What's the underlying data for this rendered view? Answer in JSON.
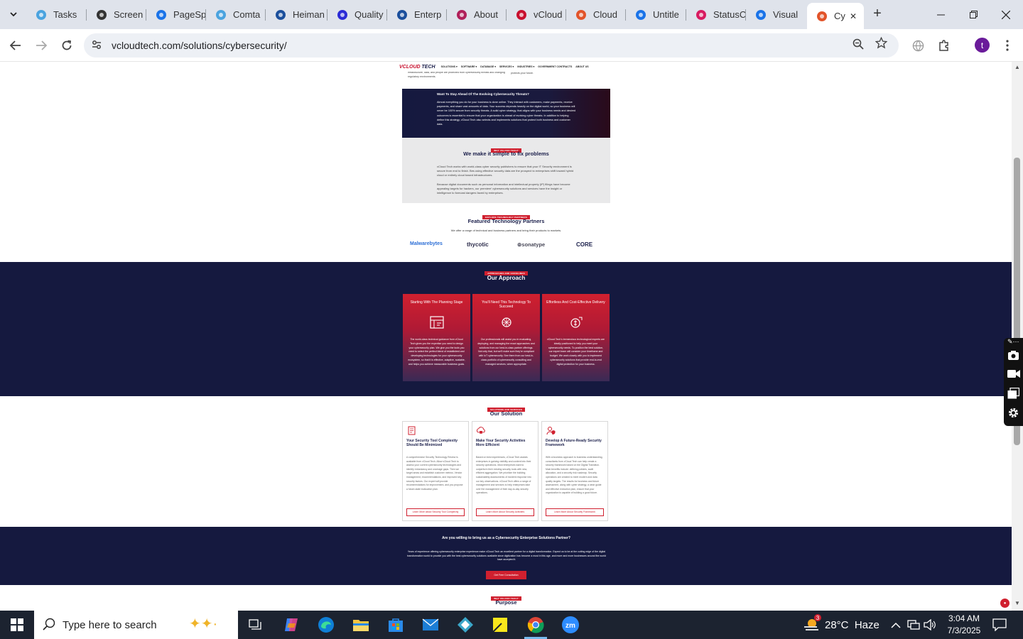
{
  "browser": {
    "tabs": [
      {
        "label": "Tasks",
        "icon": "tasks-icon",
        "color": "#4aa3df"
      },
      {
        "label": "Screen",
        "icon": "screen-icon",
        "color": "#333"
      },
      {
        "label": "PageSp",
        "icon": "pagespeed-icon",
        "color": "#1a73e8"
      },
      {
        "label": "Comta",
        "icon": "comta-icon",
        "color": "#4aa3df"
      },
      {
        "label": "Heiman",
        "icon": "heiman-icon",
        "color": "#1b4f9c"
      },
      {
        "label": "Quality",
        "icon": "quality-icon",
        "color": "#2b2bd6"
      },
      {
        "label": "Enterp",
        "icon": "enterprise-icon",
        "color": "#1b4f9c"
      },
      {
        "label": "About",
        "icon": "about-icon",
        "color": "#b0205a"
      },
      {
        "label": "vCloud",
        "icon": "vcloud-icon",
        "color": "#c8102e"
      },
      {
        "label": "Cloud",
        "icon": "cloud-icon",
        "color": "#e2542a"
      },
      {
        "label": "Untitle",
        "icon": "docs-icon",
        "color": "#1a73e8"
      },
      {
        "label": "StatusC",
        "icon": "status-icon",
        "color": "#d81b60"
      },
      {
        "label": "Visual",
        "icon": "visual-icon",
        "color": "#1a73e8"
      },
      {
        "label": "Cy",
        "icon": "cyber-icon",
        "color": "#e2542a"
      }
    ],
    "url": "vcloudtech.com/solutions/cybersecurity/",
    "profile_initial": "t"
  },
  "site": {
    "logo_main": "VCLOUD",
    "logo_accent": "TECH",
    "nav": [
      "SOLUTIONS ▾",
      "SOFTWARE ▾",
      "DATABASE ▾",
      "SERVICES ▾",
      "INDUSTRIES ▾",
      "GOVERNMENT CONTRACTS",
      "ABOUT US"
    ],
    "top_snippet_left": "infrastructure, data, and people are protected from cybersecurity threats and changing regulatory environments.",
    "top_snippet_right": "protects your future.",
    "hero_heading": "Want To Stay Ahead Of The Evolving Cybersecurity Threats?",
    "hero_text": "Almost everything you do for your business is done online. They interact with customers, make payments, receive payments, and share vast amounts of data. Your success depends heavily on the digital world, so your business will never be 100% secure from security threats. A solid cyber strategy, that aligns with your business needs and desired outcomes is essential to ensure that your organization is ahead of evolving cyber threats. In addition to helping define this strategy, vCloud Tech also selects and implements solutions that protect both business and customer data.",
    "why_badge": "WHY VCLOUD TECH?",
    "why_title": "We make it simple to fix problems",
    "why_p1": "vCloud Tech works with world-class cyber security publishers to ensure that your IT Security environment is secure from end to finish. Bes using effective security data are the prospect to enterprises shift toward hybrid cloud or entirely cloud based infrastructures.",
    "why_p2": "Because digital documents such as personal information and intellectual property (IP) filings have become appealing targets for hackers, our premiere' cybersecurity solutions and services have the insight or intelligence to forecast dangers faced by enterprises.",
    "partners_badge": "EXPLORE TECHNOLOGY PARTNERS",
    "partners_title": "Featured Technology Partners",
    "partners_sub": "We offer a range of technical and business partners and bring their products to markets.",
    "partners": [
      "Malwarebytes",
      "thycotic",
      "sonatype",
      "CORE"
    ],
    "approach_badge": "APPROACHES AND GUIDELINES",
    "approach_title": "Our Approach",
    "approach_cards": [
      {
        "title": "Starting With The Planning Stage",
        "text": "The world-class technical guidance from vCloud Tech gives you the expertise you need to design your cybersecurity plan. We give you the tools you need to select the perfect blend of established and developing technologies for your cybersecurity ecosystem, so that it is effective, adaptive, scalable, and helps you achieve measurable business goals."
      },
      {
        "title": "You'll Need This Technology To Succeed",
        "text": "Our professionals will assist you in evaluating, deploying, and managing the exact approaches and solutions from our best-in-class partner offerings. Not only that, but we'll make sure they're compliant with IoT cybersecurity. See them from our best-in-class portfolio of cybersecurity consulting and managed services, when appropriate."
      },
      {
        "title": "Effortless And Cost-Effective Delivery",
        "text": "vCloud Tech's tremendous technological experts are ideally positioned to help you meet your cybersecurity needs. To position the best solution, our expert team will consider your timeframe and budget. We work closely with you to implement cybersecurity solutions that provide end-to-end digital protection for your business."
      }
    ],
    "solution_badge": "SOLUTIONS AND SERVICES",
    "solution_title": "Our Solution",
    "solution_cards": [
      {
        "title": "Your Security Tool Complexity Should Be Minimized",
        "text": "A comprehensive Security Technology Review is available from vCloud Tech. Allow vCloud Tech to assess your current cybersecurity technologies and identify redundancy and coverage gaps. Then we target areas and establish customer metrics. Vendor management, recommendations, and improved key security factors. Our expert will provide recommendations for improvement, and you propose a future-state evaluation plan.",
        "button": "Learn More about Security Tool Complexity"
      },
      {
        "title": "Make Your Security Activities More Efficient",
        "text": "Based on best experiences, vCloud Tech assists enterprises in gaining visibility and content into their security operations. Most enterprises want to outperform their existing security tools with new, efficient aggregation. We prioritize the building sustainability assessments of incident response into our key observations. vCloud Tech offers a range of management and services to help enterprises take over the management of their day-to-day security operations.",
        "button": "Learn More About Security Activities"
      },
      {
        "title": "Develop A Future-Ready Security Framework",
        "text": "With a business approach to business understanding, consultants from vCloud Tech can help create a security framework based on the Digital Transition. Main benefits include: defining policies, audit allocation, and a security risk roadmap. Security operations are created to meet modern and data quality targets. The results for business and future assessment, along with cyber strategy, a clear guide and effective execution plan, ensure that your organization is capable of building a good future.",
        "button": "Learn More About Security Framework"
      }
    ],
    "cta_question": "Are you willing to bring us as a Cybersecurity Enterprise Solutions Partner?",
    "cta_text": "Years of experience offering cybersecurity enterprise experience make vCloud Tech an excellent partner for a digital transformation. Expect us to be at the cutting edge of the digital transformation world to provide you with the best cybersecurity solutions available since digitization has become a must in this age, and more and more businesses around the world have accepted it.",
    "cta_button": "Get Free Consultation",
    "purpose_badge": "WHY VCLOUD TECH?",
    "purpose_title": "Purpose"
  },
  "taskbar": {
    "search_placeholder": "Type here to search",
    "weather": "28°C  Haze",
    "weather_badge": "3",
    "time": "3:04 AM",
    "date": "7/3/2025"
  }
}
